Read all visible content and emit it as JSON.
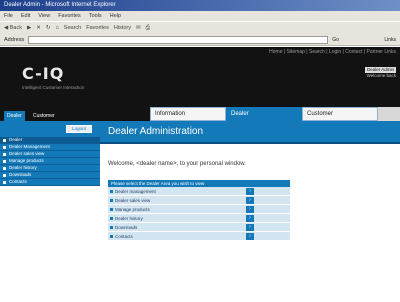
{
  "browser": {
    "title": "Dealer Admin - Microsoft Internet Explorer",
    "menu": [
      "File",
      "Edit",
      "View",
      "Favorites",
      "Tools",
      "Help"
    ],
    "toolbar": [
      "Back",
      "Forward",
      "Stop",
      "Refresh",
      "Home",
      "Search",
      "Favorites",
      "History",
      "Mail",
      "Print"
    ],
    "address_label": "Address",
    "address_value": "",
    "go_label": "Go",
    "links_label": "Links"
  },
  "header": {
    "toplinks": "Home | Sitemap | Search | Login | Contact | Partner Links",
    "logo": "C-IQ",
    "logo_sub": "Intelligent Customer Interaction",
    "badge": "Dealer Admin",
    "user_line": "Welcome back"
  },
  "nav": {
    "left_tabs": [
      "Dealer",
      "Customer"
    ],
    "main_tabs": [
      "Information",
      "Dealer",
      "Customer"
    ]
  },
  "sidebar": {
    "logout_label": "Logout",
    "items": [
      "Dealer",
      "Dealer Management",
      "Dealer sales view",
      "Manage products",
      "Dealer history",
      "Downloads",
      "Contacts"
    ]
  },
  "main": {
    "title": "Dealer Administration",
    "welcome": "Welcome, <dealer name>, to your personal window.",
    "table_header": "Please select the Dealer Area you wish to view",
    "rows": [
      "Dealer management",
      "Dealer sales view",
      "Manage products",
      "Dealer history",
      "Downloads",
      "Contacts"
    ]
  },
  "colors": {
    "accent": "#1479b8",
    "header_bg": "#121212",
    "row_bg": "#d4e5f2"
  }
}
